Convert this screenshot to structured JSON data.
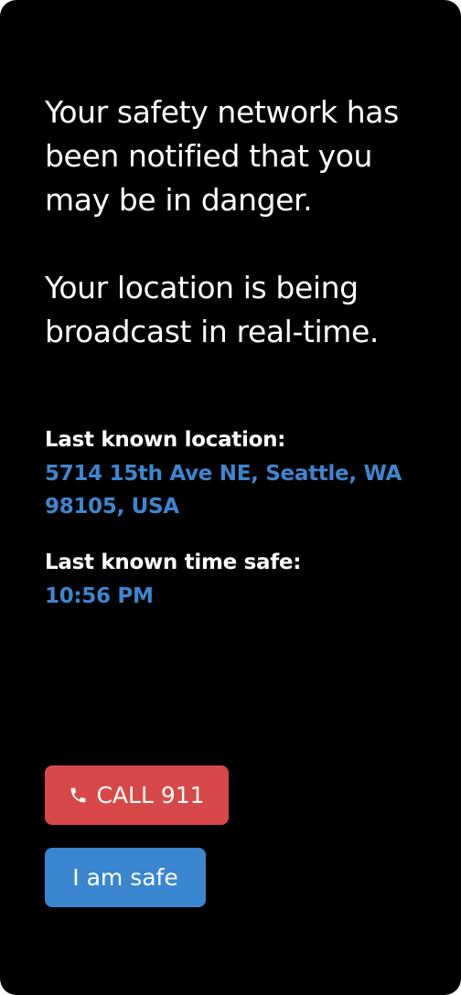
{
  "headline": {
    "line1": "Your safety network has been notified that you may be in danger.",
    "line2": "Your location is being broadcast in real-time."
  },
  "location": {
    "label": "Last known location:",
    "value": "5714 15th Ave NE, Seattle, WA 98105, USA"
  },
  "time": {
    "label": "Last known time safe:",
    "value": "10:56 PM"
  },
  "actions": {
    "call_label": "CALL 911",
    "call_icon": "phone-icon",
    "safe_label": "I am safe"
  },
  "colors": {
    "background": "#000000",
    "text": "#ffffff",
    "accent_blue": "#3d86d0",
    "call_red": "#d94848",
    "safe_blue": "#3a86d0"
  }
}
